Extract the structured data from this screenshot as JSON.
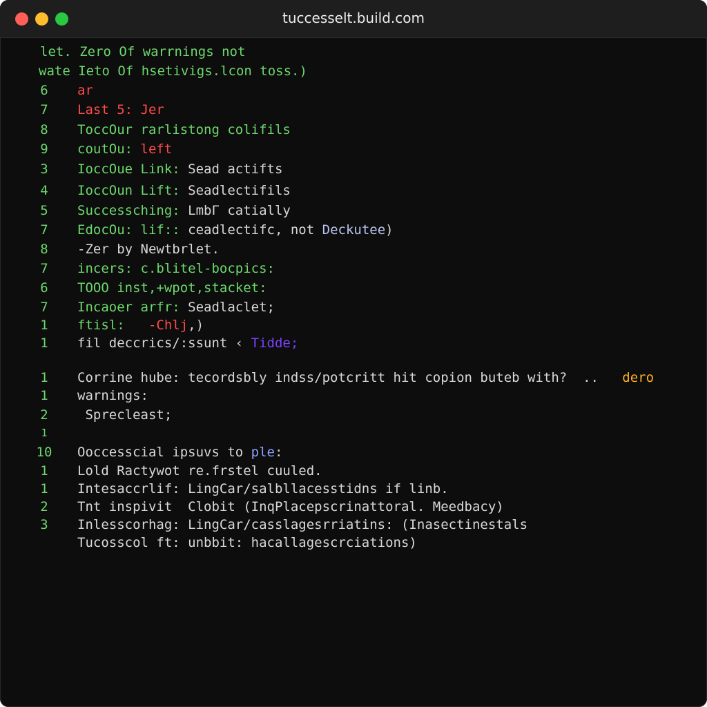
{
  "window": {
    "title": "tuccesselt.build.com",
    "icons": [
      "close-light",
      "minimize-light",
      "zoom-light"
    ]
  },
  "colors": {
    "background": "#0d0d0d",
    "green": "#6cd86c",
    "red": "#ff4a4a",
    "white": "#d8d8d8",
    "purple": "#7a42ff",
    "orange": "#ffb020"
  },
  "header_lines": [
    "let. Zero Of warrnings not",
    "wate Ieto Of hsetivigs.lcon toss.)"
  ],
  "lines": [
    {
      "num": "6",
      "parts": [
        "ar"
      ]
    },
    {
      "num": "7",
      "parts": [
        "Last 5: Jer"
      ]
    },
    {
      "num": "8",
      "parts": [
        "ToccOur rarlistong colifils"
      ]
    },
    {
      "num": "9",
      "parts": [
        "coutOu: ",
        "left"
      ]
    },
    {
      "num": "3",
      "parts": [
        "IoccOue Link: ",
        "Sead actifts"
      ]
    },
    {
      "num": "4",
      "parts": [
        "IoccOun Lift: ",
        "Seadlectifils"
      ]
    },
    {
      "num": "5",
      "parts": [
        "Successching: ",
        "LmbΓ catially"
      ]
    },
    {
      "num": "7",
      "parts": [
        "EdocOu: lif:: ",
        "ceadlectifc, not ",
        "Deckutee",
        ")"
      ]
    },
    {
      "num": "8",
      "parts": [
        "-Zer by Newtbrlet."
      ]
    },
    {
      "num": "7",
      "parts": [
        "incers: c.blitel-bocpics:"
      ]
    },
    {
      "num": "6",
      "parts": [
        "TOOO inst,+wpot,stacket:"
      ]
    },
    {
      "num": "7",
      "parts": [
        "Incaoer arfr: ",
        "Seadlaclet;"
      ]
    },
    {
      "num": "1",
      "parts": [
        "ftisl:  ",
        " -Chlj",
        ",)"
      ]
    },
    {
      "num": "1",
      "parts": [
        "fil deccrics/:ssunt ‹ ",
        "Tidde;"
      ]
    },
    {
      "num": "1",
      "parts": [
        "Corrine hube: tecordsbly indss/potcritt hit copion buteb with?  ..   ",
        "dero"
      ]
    },
    {
      "num": "1",
      "parts": [
        "warnings:"
      ]
    },
    {
      "num": "2",
      "parts": [
        " Sprecleast;"
      ]
    },
    {
      "num": "1",
      "parts": [
        ""
      ]
    },
    {
      "num": "10",
      "parts": [
        "Ooccesscial ipsuvs to ",
        "ple",
        ":"
      ]
    },
    {
      "num": "1",
      "parts": [
        "Lold Ractywot re.frstel cuuled."
      ]
    },
    {
      "num": "1",
      "parts": [
        "Intesaccrlif: LingCar/salbllacesstidns if linb."
      ]
    },
    {
      "num": "2",
      "parts": [
        "Tnt inspivit  Clobit (InqPlacepscrinattoral. Meedbacy)"
      ]
    },
    {
      "num": "3",
      "parts": [
        "Inlesscorhag: LingCar/casslagesrriatins: (Inasectinestals"
      ]
    },
    {
      "num": "",
      "parts": [
        "Tucosscol ft: unbbit: hacallagescrciations)"
      ]
    }
  ]
}
